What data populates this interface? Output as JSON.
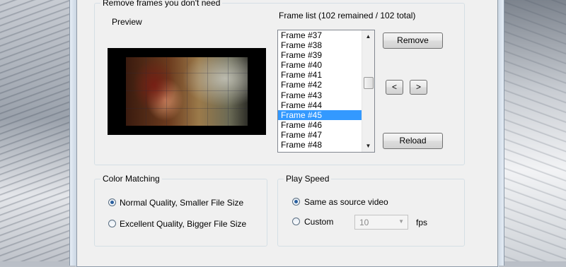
{
  "remove_frames": {
    "title": "Remove frames you don't need",
    "preview_label": "Preview",
    "frame_list_label": "Frame list (102 remained / 102 total)",
    "frames": [
      "Frame #37",
      "Frame #38",
      "Frame #39",
      "Frame #40",
      "Frame #41",
      "Frame #42",
      "Frame #43",
      "Frame #44",
      "Frame #45",
      "Frame #46",
      "Frame #47",
      "Frame #48"
    ],
    "selected_frame": "Frame #45",
    "remove_label": "Remove",
    "prev_label": "<",
    "next_label": ">",
    "reload_label": "Reload"
  },
  "color_matching": {
    "title": "Color Matching",
    "option_normal": "Normal Quality, Smaller File Size",
    "option_excellent": "Excellent Quality, Bigger File Size",
    "selected": "Normal Quality, Smaller File Size"
  },
  "play_speed": {
    "title": "Play Speed",
    "option_same": "Same as source video",
    "option_custom": "Custom",
    "custom_value": "10",
    "unit": "fps",
    "selected": "Same as source video"
  },
  "colors": {
    "selection": "#3399ff",
    "window_bg": "#f0f0f0"
  }
}
